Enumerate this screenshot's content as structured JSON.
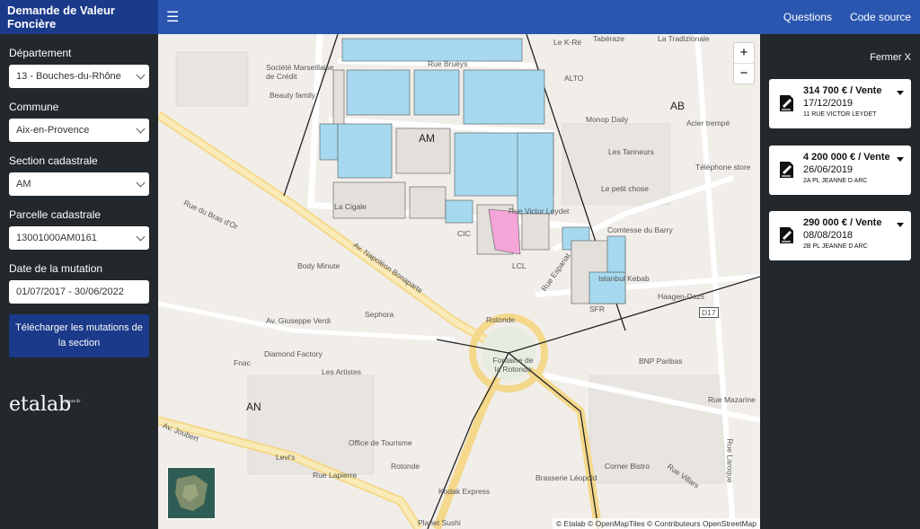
{
  "header": {
    "app_title": "Demande de Valeur Foncière",
    "menu_icon": "hamburger-icon",
    "links": [
      "Questions",
      "Code source"
    ]
  },
  "sidebar": {
    "departement_label": "Département",
    "departement_value": "13 - Bouches-du-Rhône",
    "commune_label": "Commune",
    "commune_value": "Aix-en-Provence",
    "section_label": "Section cadastrale",
    "section_value": "AM",
    "parcelle_label": "Parcelle cadastrale",
    "parcelle_value": "13001000AM0161",
    "date_label": "Date de la mutation",
    "date_value": "01/07/2017 - 30/06/2022",
    "download_label": "Télécharger les mutations de la section",
    "logo_text": "etalab",
    "logo_sup": "gouv.fr"
  },
  "map": {
    "zoom_in": "+",
    "zoom_out": "−",
    "attribution": "© Etalab © OpenMapTiles © Contributeurs OpenStreetMap",
    "section_labels": [
      "AM",
      "AB",
      "AN"
    ],
    "labels": [
      "Société Marseillaise de Crédit",
      "Beauty family",
      "Rue Bruéys",
      "Le K-Ré",
      "Tabéraze",
      "La Tradizionale",
      "ALTO",
      "Monop Daily",
      "Acier trempé",
      "Les Tanneurs",
      "Téléphone store",
      "Le petit chose",
      "Rue du Bras d'Or",
      "Av. Napoléon Bonaparte",
      "CIC",
      "LCL",
      "Rue Victor Leydet",
      "Comtesse du Barry",
      "Istanbul Kebab",
      "Haagen-Dazs",
      "SFR",
      "Body Minute",
      "Sephora",
      "Av. Giuseppe Verdi",
      "Rotonde",
      "Fontaine de la Rotonde",
      "Diamond Factory",
      "Les Artistes",
      "Fnac",
      "BNP Paribas",
      "Rue Mazarine",
      "Office de Tourisme",
      "Levi's",
      "Rue Lapierre",
      "Rotonde",
      "Corner Bistro",
      "Brasserie Léopold",
      "Rue Villars",
      "Kodak Express",
      "Planet Sushi",
      "Rue Laroque",
      "D17",
      "Av. Joubert",
      "Rue Espariat",
      "La Cigale"
    ]
  },
  "panel": {
    "close_label": "Fermer X",
    "mutations": [
      {
        "price": "314 700 € / Vente",
        "date": "17/12/2019",
        "address": "11 RUE VICTOR LEYDET"
      },
      {
        "price": "4 200 000 € / Vente",
        "date": "26/06/2019",
        "address": "2A PL JEANNE D ARC"
      },
      {
        "price": "290 000 € / Vente",
        "date": "08/08/2018",
        "address": "2B PL JEANNE D ARC"
      }
    ]
  },
  "colors": {
    "sold_parcel": "#a6d9ef",
    "selected_parcel": "#f4a6d8",
    "parcel": "#e3dfdb",
    "road": "#f7e3a1"
  }
}
